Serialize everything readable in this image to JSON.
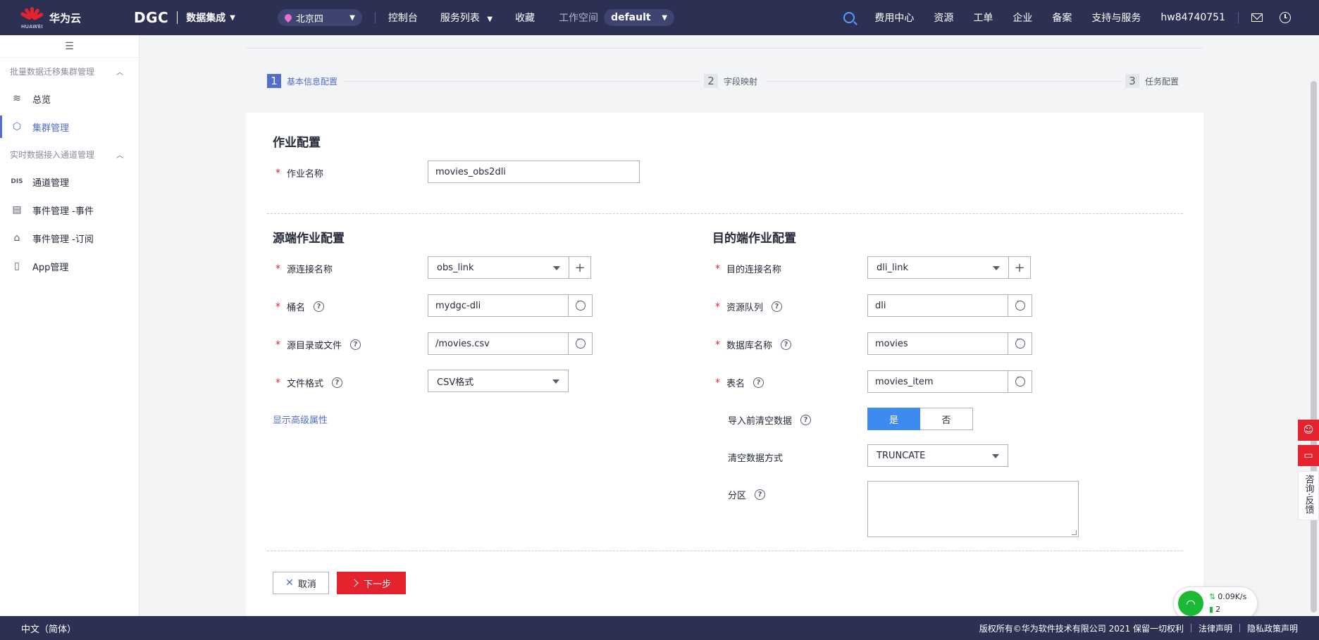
{
  "topbar": {
    "logo_text": "华为云",
    "logo_sub": "HUAWEI",
    "product": "DGC",
    "product_sub": "数据集成",
    "region": "北京四",
    "nav": [
      "控制台",
      "服务列表",
      "收藏"
    ],
    "workspace_label": "工作空间",
    "workspace_value": "default",
    "right_nav": [
      "费用中心",
      "资源",
      "工单",
      "企业",
      "备案",
      "支持与服务",
      "hw84740751"
    ]
  },
  "sidebar": {
    "groups": [
      {
        "title": "批量数据迁移集群管理",
        "items": [
          {
            "label": "总览",
            "icon": "layers-icon",
            "active": false
          },
          {
            "label": "集群管理",
            "icon": "cluster-icon",
            "active": true
          }
        ]
      },
      {
        "title": "实时数据接入通道管理",
        "items": [
          {
            "label": "通道管理",
            "icon": "dis-icon",
            "active": false
          },
          {
            "label": "事件管理 -事件",
            "icon": "event-icon",
            "active": false
          },
          {
            "label": "事件管理 -订阅",
            "icon": "subscribe-icon",
            "active": false
          },
          {
            "label": "App管理",
            "icon": "app-icon",
            "active": false
          }
        ]
      }
    ]
  },
  "steps": [
    {
      "num": "1",
      "label": "基本信息配置",
      "active": true
    },
    {
      "num": "2",
      "label": "字段映射",
      "active": false
    },
    {
      "num": "3",
      "label": "任务配置",
      "active": false
    }
  ],
  "job": {
    "title": "作业配置",
    "name_label": "作业名称",
    "name_value": "movies_obs2dli"
  },
  "source": {
    "title": "源端作业配置",
    "link_label": "源连接名称",
    "link_value": "obs_link",
    "bucket_label": "桶名",
    "bucket_value": "mydgc-dli",
    "path_label": "源目录或文件",
    "path_value": "/movies.csv",
    "format_label": "文件格式",
    "format_value": "CSV格式",
    "advanced_link": "显示高级属性"
  },
  "dest": {
    "title": "目的端作业配置",
    "link_label": "目的连接名称",
    "link_value": "dli_link",
    "queue_label": "资源队列",
    "queue_value": "dli",
    "db_label": "数据库名称",
    "db_value": "movies",
    "table_label": "表名",
    "table_value": "movies_item",
    "clear_label": "导入前清空数据",
    "clear_yes": "是",
    "clear_no": "否",
    "clear_mode_label": "清空数据方式",
    "clear_mode_value": "TRUNCATE",
    "partition_label": "分区"
  },
  "actions": {
    "cancel": "取消",
    "next": "下一步"
  },
  "float": {
    "feedback": "咨询·反馈"
  },
  "net": {
    "speed": "0.09K/s",
    "count": "2"
  },
  "footer": {
    "lang": "中文（简体）",
    "copyright": "版权所有©华为软件技术有限公司 2021 保留一切权利",
    "legal": "法律声明",
    "privacy": "隐私政策声明"
  },
  "colors": {
    "topbar": "#2c3154",
    "accent": "#526ecc",
    "danger": "#e4232e",
    "toggle_on": "#3d8bf0"
  }
}
